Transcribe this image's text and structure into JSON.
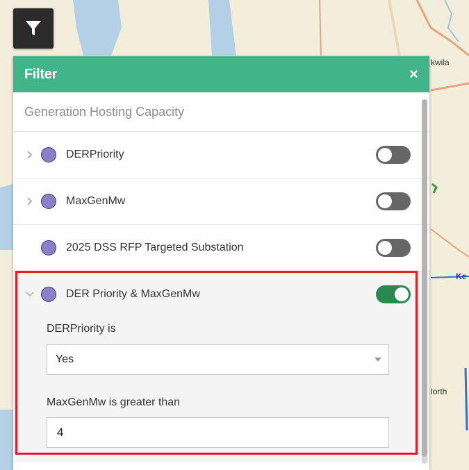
{
  "panel": {
    "title": "Filter",
    "close_symbol": "×",
    "layer_name": "Generation Hosting Capacity"
  },
  "filters": [
    {
      "label": "DERPriority",
      "enabled": false,
      "expandable": true
    },
    {
      "label": "MaxGenMw",
      "enabled": false,
      "expandable": true
    },
    {
      "label": "2025 DSS RFP Targeted Substation",
      "enabled": false,
      "expandable": false
    },
    {
      "label": "DER Priority & MaxGenMw",
      "enabled": true,
      "expandable": true,
      "expanded": true
    }
  ],
  "expanded_filter": {
    "condition1_label": "DERPriority is",
    "condition1_value": "Yes",
    "condition2_label": "MaxGenMw is greater than",
    "condition2_value": "4"
  },
  "map": {
    "place_labels": [
      "kwila",
      "Ke",
      "lorth"
    ]
  },
  "colors": {
    "header": "#41b48c",
    "toggle_on": "#2a8a4e",
    "toggle_off": "#666666",
    "symbol_fill": "#8a7fc9",
    "highlight": "#e01e24"
  },
  "icons": {
    "filter_button": "filter-icon",
    "close": "close-icon",
    "collapsed": "chevron-right-icon",
    "expanded": "chevron-down-icon",
    "dropdown": "caret-down-icon"
  }
}
